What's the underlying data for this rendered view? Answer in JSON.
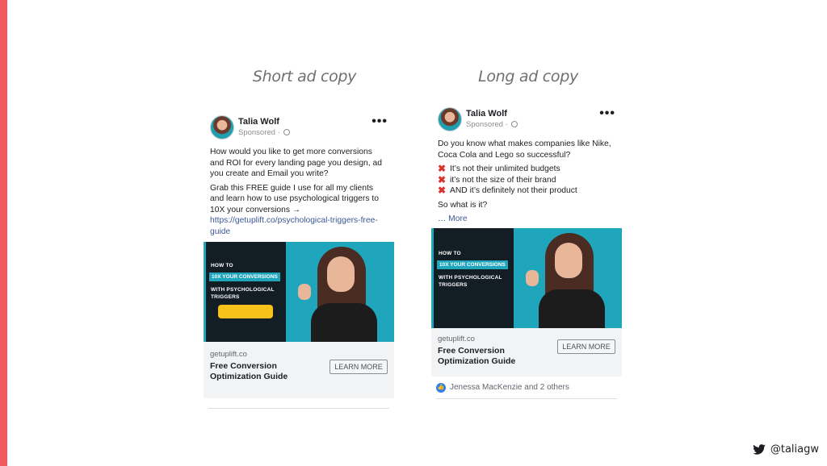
{
  "slide": {
    "accent_color": "#f25a5f",
    "twitter_handle": "@taliagw"
  },
  "columns": {
    "short": {
      "title": "Short ad copy"
    },
    "long": {
      "title": "Long ad copy"
    }
  },
  "ad_short": {
    "author": "Talia Wolf",
    "meta": "Sponsored ·",
    "body_1": "How would you like to get more conversions and ROI for every landing page you design, ad you create and Email you write?",
    "body_2": "Grab this FREE guide I use for all my clients and learn how to use psychological triggers to 10X your conversions →",
    "link": "https://getuplift.co/psychological-triggers-free-guide",
    "creative": {
      "line1": "HOW TO",
      "highlight": "10X YOUR CONVERSIONS",
      "line2": "WITH PSYCHOLOGICAL",
      "line3": "TRIGGERS"
    },
    "domain": "getuplift.co",
    "headline": "Free Conversion Optimization Guide",
    "cta": "LEARN MORE"
  },
  "ad_long": {
    "author": "Talia Wolf",
    "meta": "Sponsored ·",
    "body_1": "Do you know what makes companies like Nike, Coca Cola and Lego so successful?",
    "bullets": [
      "It’s not their unlimited budgets",
      "it’s not the size of their brand",
      "AND it’s definitely not their product"
    ],
    "bullet_mark": "✖",
    "body_2": "So what is it?",
    "more": "… More",
    "creative": {
      "line1": "HOW TO",
      "highlight": "10X YOUR CONVERSIONS",
      "line2": "WITH PSYCHOLOGICAL",
      "line3": "TRIGGERS"
    },
    "domain": "getuplift.co",
    "headline": "Free Conversion Optimization Guide",
    "cta": "LEARN MORE",
    "reactions": "Jenessa MacKenzie and 2 others"
  }
}
